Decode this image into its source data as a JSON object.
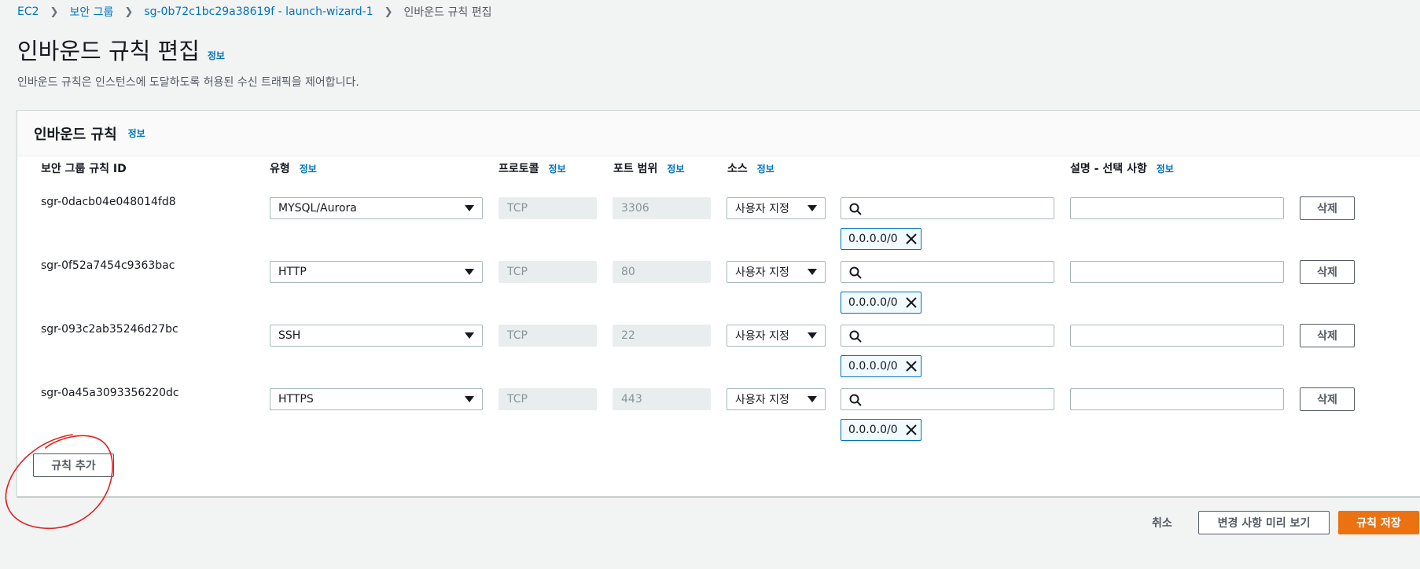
{
  "breadcrumb": {
    "items": [
      "EC2",
      "보안 그룹",
      "sg-0b72c1bc29a38619f - launch-wizard-1"
    ],
    "current": "인바운드 규칙 편집"
  },
  "page": {
    "title": "인바운드 규칙 편집",
    "info": "정보",
    "description": "인바운드 규칙은 인스턴스에 도달하도록 허용된 수신 트래픽을 제어합니다."
  },
  "panel": {
    "title": "인바운드 규칙",
    "info": "정보"
  },
  "columns": {
    "rule_id": "보안 그룹 규칙 ID",
    "type": "유형",
    "protocol": "프로토콜",
    "port_range": "포트 범위",
    "source": "소스",
    "description": "설명 - 선택 사항",
    "info": "정보"
  },
  "rules": [
    {
      "id": "sgr-0dacb04e048014fd8",
      "type": "MYSQL/Aurora",
      "protocol": "TCP",
      "port": "3306",
      "source_mode": "사용자 지정",
      "search_value": "",
      "cidr": "0.0.0.0/0",
      "description": "",
      "delete": "삭제"
    },
    {
      "id": "sgr-0f52a7454c9363bac",
      "type": "HTTP",
      "protocol": "TCP",
      "port": "80",
      "source_mode": "사용자 지정",
      "search_value": "",
      "cidr": "0.0.0.0/0",
      "description": "",
      "delete": "삭제"
    },
    {
      "id": "sgr-093c2ab35246d27bc",
      "type": "SSH",
      "protocol": "TCP",
      "port": "22",
      "source_mode": "사용자 지정",
      "search_value": "",
      "cidr": "0.0.0.0/0",
      "description": "",
      "delete": "삭제"
    },
    {
      "id": "sgr-0a45a3093356220dc",
      "type": "HTTPS",
      "protocol": "TCP",
      "port": "443",
      "source_mode": "사용자 지정",
      "search_value": "",
      "cidr": "0.0.0.0/0",
      "description": "",
      "delete": "삭제"
    }
  ],
  "actions": {
    "add_rule": "규칙 추가",
    "cancel": "취소",
    "preview": "변경 사항 미리 보기",
    "save": "규칙 저장"
  },
  "colors": {
    "link": "#0073bb",
    "primary": "#ec7211",
    "annotation": "#e02020"
  }
}
